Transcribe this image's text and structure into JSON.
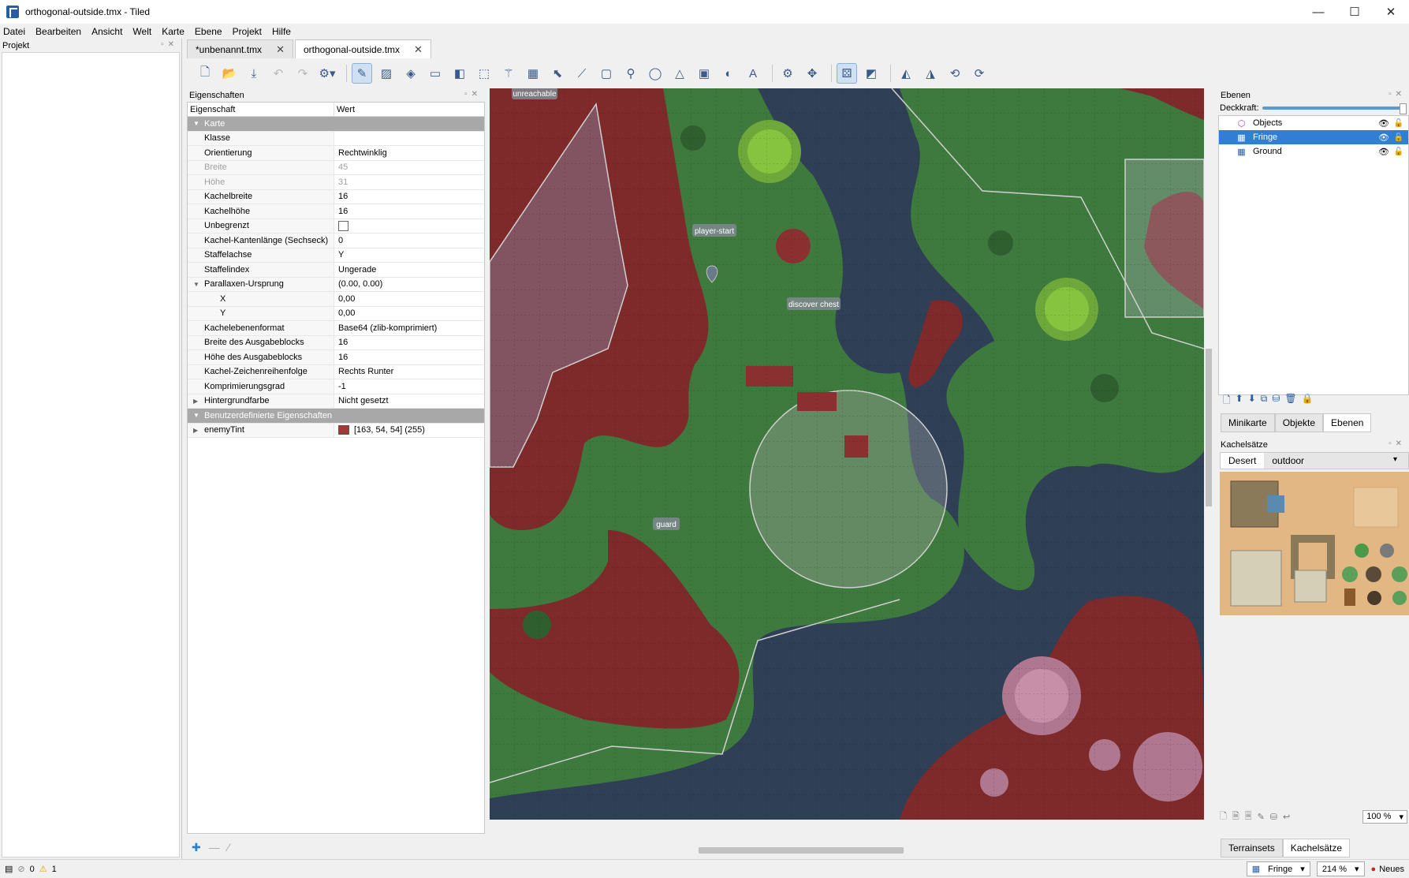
{
  "window": {
    "title": "orthogonal-outside.tmx - Tiled",
    "minimize": "—",
    "maximize": "☐",
    "close": "✕"
  },
  "menu": [
    "Datei",
    "Bearbeiten",
    "Ansicht",
    "Welt",
    "Karte",
    "Ebene",
    "Projekt",
    "Hilfe"
  ],
  "project_panel": {
    "title": "Projekt"
  },
  "tabs": [
    {
      "label": "*unbenannt.tmx"
    },
    {
      "label": "orthogonal-outside.tmx"
    }
  ],
  "properties": {
    "title": "Eigenschaften",
    "col_key": "Eigenschaft",
    "col_value": "Wert",
    "group_map": "Karte",
    "rows": [
      {
        "k": "Klasse",
        "v": ""
      },
      {
        "k": "Orientierung",
        "v": "Rechtwinklig"
      },
      {
        "k": "Breite",
        "v": "45"
      },
      {
        "k": "Höhe",
        "v": "31"
      },
      {
        "k": "Kachelbreite",
        "v": "16"
      },
      {
        "k": "Kachelhöhe",
        "v": "16"
      },
      {
        "k": "Unbegrenzt",
        "v": ""
      },
      {
        "k": "Kachel-Kantenlänge (Sechseck)",
        "v": "0"
      },
      {
        "k": "Staffelachse",
        "v": "Y"
      },
      {
        "k": "Staffelindex",
        "v": "Ungerade"
      },
      {
        "k": "Parallaxen-Ursprung",
        "v": "(0.00, 0.00)"
      },
      {
        "k": "X",
        "v": "0,00"
      },
      {
        "k": "Y",
        "v": "0,00"
      },
      {
        "k": "Kachelebenenformat",
        "v": "Base64 (zlib-komprimiert)"
      },
      {
        "k": "Breite des Ausgabeblocks",
        "v": "16"
      },
      {
        "k": "Höhe des Ausgabeblocks",
        "v": "16"
      },
      {
        "k": "Kachel-Zeichenreihenfolge",
        "v": "Rechts Runter"
      },
      {
        "k": "Komprimierungsgrad",
        "v": "-1"
      },
      {
        "k": "Hintergrundfarbe",
        "v": "Nicht gesetzt"
      }
    ],
    "group_custom": "Benutzerdefinierte Eigenschaften",
    "custom": {
      "k": "enemyTint",
      "v": "[163, 54, 54] (255)",
      "color": "#a33636"
    }
  },
  "map_labels": {
    "unreachable": "unreachable",
    "player_start": "player-start",
    "discover_chest": "discover chest",
    "guard": "guard"
  },
  "layers_panel": {
    "title": "Ebenen",
    "opacity_label": "Deckkraft:",
    "layers": [
      {
        "name": "Objects"
      },
      {
        "name": "Fringe"
      },
      {
        "name": "Ground"
      }
    ]
  },
  "bottom_tabs": [
    "Minikarte",
    "Objekte",
    "Ebenen"
  ],
  "tilesets_panel": {
    "title": "Kachelsätze",
    "tabs": [
      "Desert",
      "outdoor"
    ],
    "zoom": "100 %"
  },
  "ts_bottom_tabs": [
    "Terrainsets",
    "Kachelsätze"
  ],
  "status": {
    "errors": "0",
    "warnings": "1",
    "layer": "Fringe",
    "zoom": "214 %",
    "news": "Neues"
  },
  "colors": {
    "grass": "#3e7a3e",
    "water": "#2f3f55",
    "dirt": "#7e2a2a",
    "selection": "#2f7fd4"
  }
}
